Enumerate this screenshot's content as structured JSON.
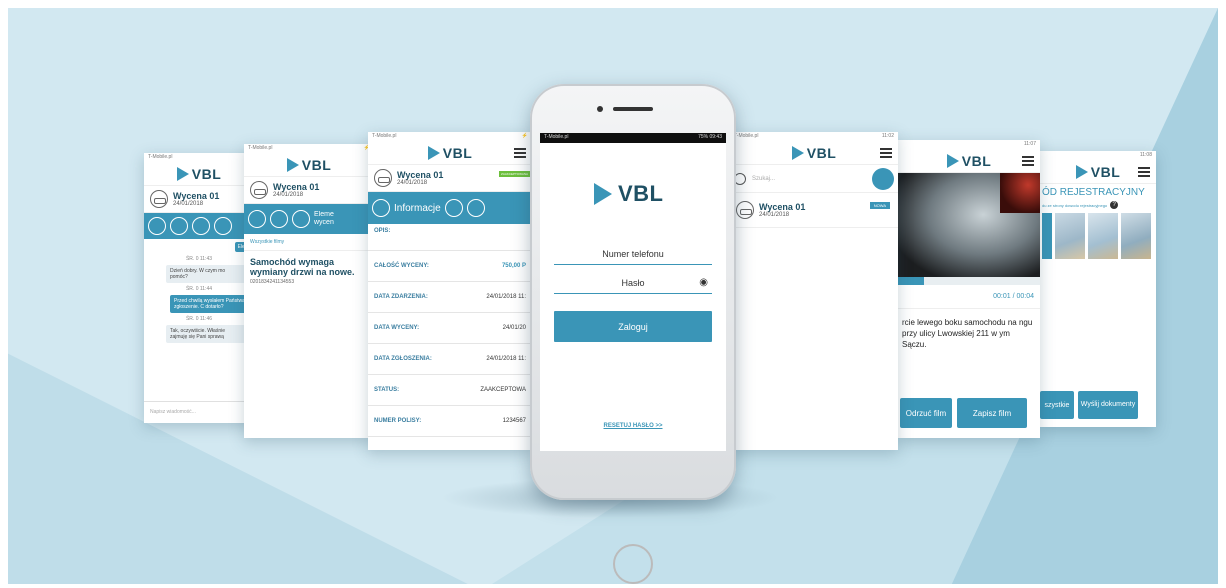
{
  "brand": {
    "logo": "VBL",
    "accent": "#3a95b7",
    "dark": "#1f5064"
  },
  "screen_far_left": {
    "status": "T-Mobile.pl",
    "item_title": "Wycena 01",
    "item_date": "24/01/2018",
    "chips": [
      "Elem"
    ],
    "messages": [
      {
        "time": "ŚR. 0 11:43"
      },
      {
        "text": "Dzień dobry. W czym mo pomóc?"
      },
      {
        "time": "ŚR. 0 11:44"
      },
      {
        "text": "Przed chwilą wysłałem Państwa zgłoszenie. C dotarło?"
      },
      {
        "time": "ŚR. 0 11:46"
      },
      {
        "text": "Tak, oczywiście. Właśnie zajmuję się Pani sprawą"
      }
    ],
    "input_placeholder": "Napisz wiadomość..."
  },
  "screen_left2": {
    "status": "T-Mobile.pl",
    "item_title": "Wycena 01",
    "item_date": "24/01/2018",
    "tab_label": "Eleme wycen",
    "filter": "Wszystkie filmy",
    "heading": "Samochód wymaga wymiany drzwi na nowe.",
    "code": "0201834241134553"
  },
  "screen_left3": {
    "status": "T-Mobile.pl",
    "item_title": "Wycena 01",
    "item_date": "24/01/2018",
    "badge": "ZAAKCEPTOWANA",
    "tab_active": "Informacje",
    "rows": [
      {
        "label": "OPIS:",
        "value": ""
      },
      {
        "label": "CAŁOŚĆ WYCENY:",
        "value": "750,00 P"
      },
      {
        "label": "DATA ZDARZENIA:",
        "value": "24/01/2018 11:"
      },
      {
        "label": "DATA WYCENY:",
        "value": "24/01/20"
      },
      {
        "label": "DATA ZGŁOSZENIA:",
        "value": "24/01/2018 11:"
      },
      {
        "label": "STATUS:",
        "value": "ZAAKCEPTOWA"
      },
      {
        "label": "NUMER POLISY:",
        "value": "1234567"
      }
    ]
  },
  "main": {
    "status_left": "T-Mobile.pl",
    "status_right": "75% 09:43",
    "phone_placeholder": "Numer telefonu",
    "password_placeholder": "Hasło",
    "login_button": "Zaloguj",
    "reset_link": "RESETUJ HASŁO >>"
  },
  "screen_right1": {
    "status": "T-Mobile.pl",
    "search_placeholder": "Szukaj...",
    "item_title": "Wycena 01",
    "item_date": "24/01/2018",
    "badge": "NOWA"
  },
  "screen_right2": {
    "time": "00:01 / 00:04",
    "progress": 0.18,
    "description": "rcie lewego boku samochodu na ngu przy ulicy Lwowskiej 211 w ym Sączu.",
    "reject_button": "Odrzuć film",
    "save_button": "Zapisz film"
  },
  "screen_right3": {
    "title": "ÓD REJESTRACYJNY",
    "subtitle": "du ze strony dowodu rejestracyjnego",
    "all_button": "szystkie",
    "send_button": "Wyślij dokumenty"
  }
}
